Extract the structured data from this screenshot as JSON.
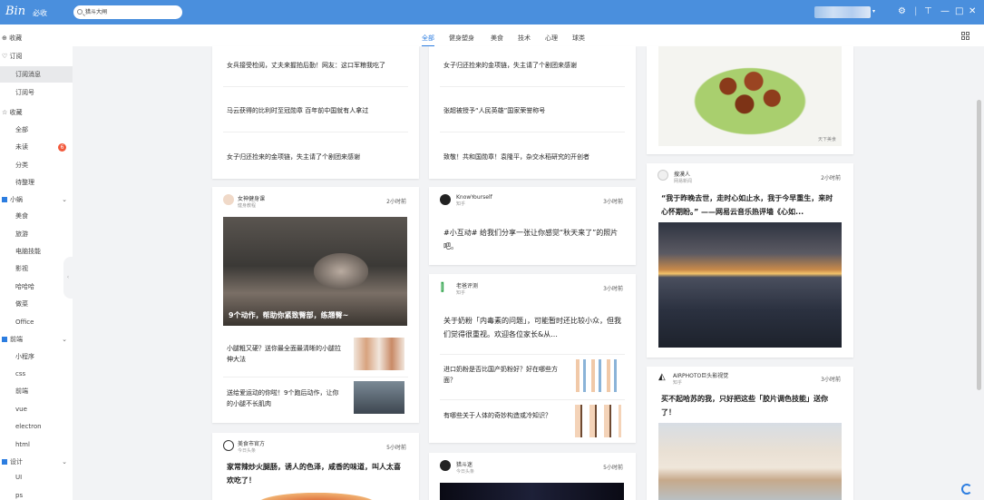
{
  "app": {
    "logo": "Bin",
    "subtitle": "必收"
  },
  "search": {
    "value": "猎斗大闸"
  },
  "sidebar": {
    "favorites": "收藏",
    "subscribe": "订阅",
    "sub_items": [
      "订阅消息",
      "订阅号"
    ],
    "collect": "收藏",
    "collect_items": [
      "全部",
      "未读",
      "分类",
      "待整理"
    ],
    "unread_badge": "6",
    "group1": "小蜗",
    "group1_items": [
      "美食",
      "旅游",
      "电脑技能",
      "影视",
      "哈哈哈",
      "做菜",
      "Office"
    ],
    "group2": "前端",
    "group2_items": [
      "小程序",
      "css",
      "前端",
      "vue",
      "electron",
      "html"
    ],
    "group3": "设计",
    "group3_items": [
      "UI",
      "ps"
    ]
  },
  "tabs": [
    "全部",
    "健身塑身",
    "美食",
    "技术",
    "心理",
    "球类"
  ],
  "col1": {
    "top_lines": [
      "女兵接受检阅，丈夫来握拍后勤！网友：这口军粮我吃了",
      "马云获得的比利时至冠勋章 百年前中国就有人拿过",
      "女子归还捡来的金项链，失主请了个剧团来感谢"
    ],
    "card2": {
      "source": "女神健身课",
      "source_sub": "健身教程",
      "time": "2小时前",
      "image_caption": "9个动作，帮助你紧致臀部，练翘臀~",
      "items": [
        "小腿粗又硬？送你最全面最清晰的小腿拉伸大法",
        "送给爱运动的你啦！9个跑后动作，让你的小腿不长肌肉"
      ]
    },
    "card3": {
      "source": "美食市官方",
      "source_sub": "今日头条",
      "time": "5小时前",
      "title": "家常辣炒火腿肠，诱人的色泽，咸香的味道，叫人太喜欢吃了！"
    }
  },
  "col2": {
    "top_lines": [
      "女子归还捡来的金项链，失主请了个剧团来感谢",
      "张超被授予“人民英雄”国家荣誉称号",
      "致敬！共和国勋章！袁隆平，杂交水稻研究的开创者"
    ],
    "card2": {
      "source": "KnowYourself",
      "source_sub": "知乎",
      "time": "3小时前",
      "title": "#小互动# 给我们分享一张让你感觉“秋天来了”的照片吧。"
    },
    "card3": {
      "source": "老爸评测",
      "source_sub": "知乎",
      "time": "3小时前",
      "title": "关于奶粉「内毒素的问题」，可能暂时还比较小众，但我们觉得很重视。欢迎各位家长&从...",
      "items": [
        "进口奶粉是否比国产奶粉好？好在哪些方面？",
        "有哪些关于人体的奇妙构造或冷知识？"
      ]
    },
    "card4": {
      "source": "猎斗迷",
      "source_sub": "今日头条",
      "time": "5小时前"
    }
  },
  "col3": {
    "card1": {
      "image_credit": "天下美食"
    },
    "card2": {
      "source": "搜漠人",
      "source_sub": "网易新闻",
      "time": "2小时前",
      "title": "“我于昨晚去世，走时心如止水，我于今早重生，来时心怀期盼。” ——网易云音乐热评墙《心如..."
    },
    "card3": {
      "source": "AIRPHOTO巨头影视觉",
      "source_sub": "知乎",
      "time": "3小时前",
      "title": "买不起哈苏的我，只好把这些「胶片调色技能」送你了！"
    }
  },
  "colors": {
    "accent": "#2c7de0",
    "topbar": "#4a8fdd"
  }
}
